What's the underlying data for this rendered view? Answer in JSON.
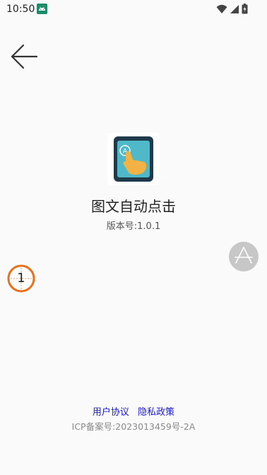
{
  "status_bar": {
    "time": "10:50"
  },
  "app": {
    "name": "图文自动点击",
    "version": "版本号:1.0.1"
  },
  "click_marker": {
    "number": "1"
  },
  "footer": {
    "user_agreement": "用户协议",
    "privacy_policy": "隐私政策",
    "icp": "ICP备案号:2023013459号-2A"
  },
  "colors": {
    "background": "#fafafa",
    "link": "#1a1ad0",
    "marker": "#e8701a",
    "icon_frame": "#1f3a4a",
    "icon_screen": "#4fb8c9",
    "icon_hand": "#f2b344",
    "float_button": "#c7c7c7"
  },
  "icons": {
    "back": "arrow-left-icon",
    "float": "triangle-a-icon",
    "wifi": "wifi-icon",
    "signal": "signal-icon",
    "battery": "battery-icon",
    "status_app": "android-icon"
  }
}
